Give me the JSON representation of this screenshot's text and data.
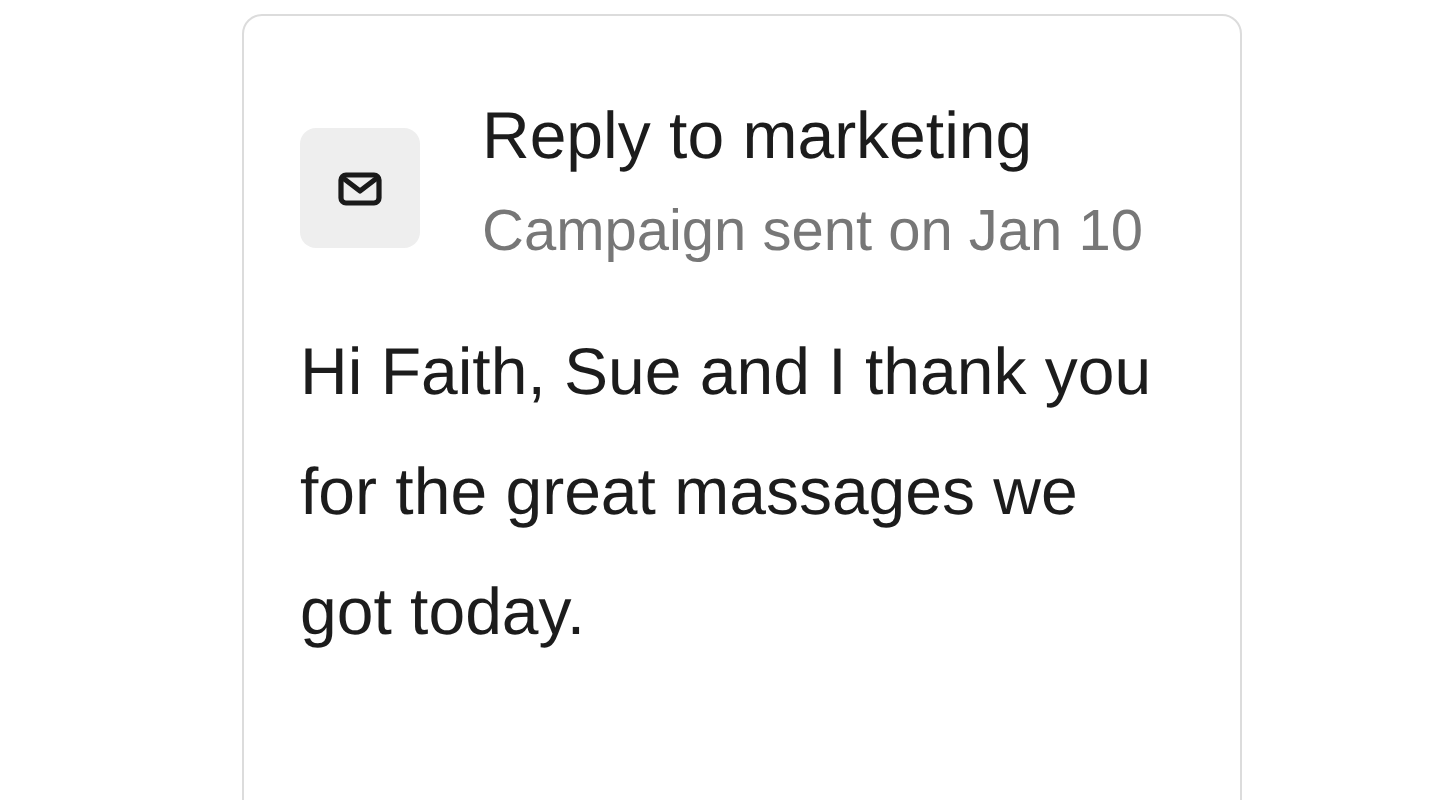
{
  "notification": {
    "title": "Reply to marketing",
    "subtitle": "Campaign sent on Jan 10",
    "message": "Hi Faith, Sue and I thank you for the great massages we got today."
  }
}
